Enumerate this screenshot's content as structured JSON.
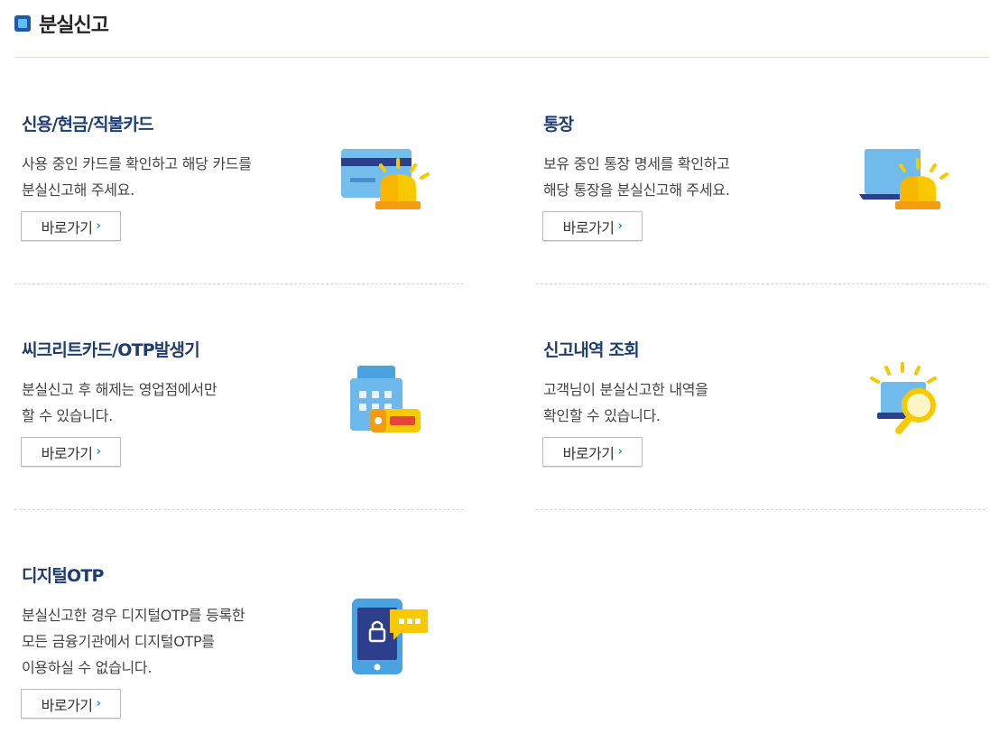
{
  "header": {
    "title": "분실신고"
  },
  "sections": [
    {
      "title": "신용/현금/직불카드",
      "desc": "사용 중인 카드를 확인하고 해당 카드를\n분실신고해 주세요.",
      "button": "바로가기"
    },
    {
      "title": "통장",
      "desc": "보유 중인 통장 명세를 확인하고\n해당 통장을 분실신고해 주세요.",
      "button": "바로가기"
    },
    {
      "title": "씨크리트카드/OTP발생기",
      "desc": "분실신고 후 해제는 영업점에서만\n할 수 있습니다.",
      "button": "바로가기"
    },
    {
      "title": "신고내역 조회",
      "desc": "고객님이 분실신고한 내역을\n확인할 수 있습니다.",
      "button": "바로가기"
    },
    {
      "title": "디지털OTP",
      "desc": "분실신고한 경우 디지털OTP를 등록한\n모든 금융기관에서 디지털OTP를\n이용하실 수 없습니다.",
      "button": "바로가기"
    }
  ],
  "icons": {
    "card": "card-alarm-icon",
    "bankbook": "bankbook-alarm-icon",
    "secure_card": "secure-card-otp-icon",
    "history": "search-report-icon",
    "digital_otp": "smartphone-otp-icon"
  },
  "colors": {
    "title": "#1f3d6e",
    "accent_blue": "#1790d6",
    "header_rule": "#f2e08a",
    "alarm_yellow": "#f9c900",
    "alarm_orange": "#f39c12"
  }
}
